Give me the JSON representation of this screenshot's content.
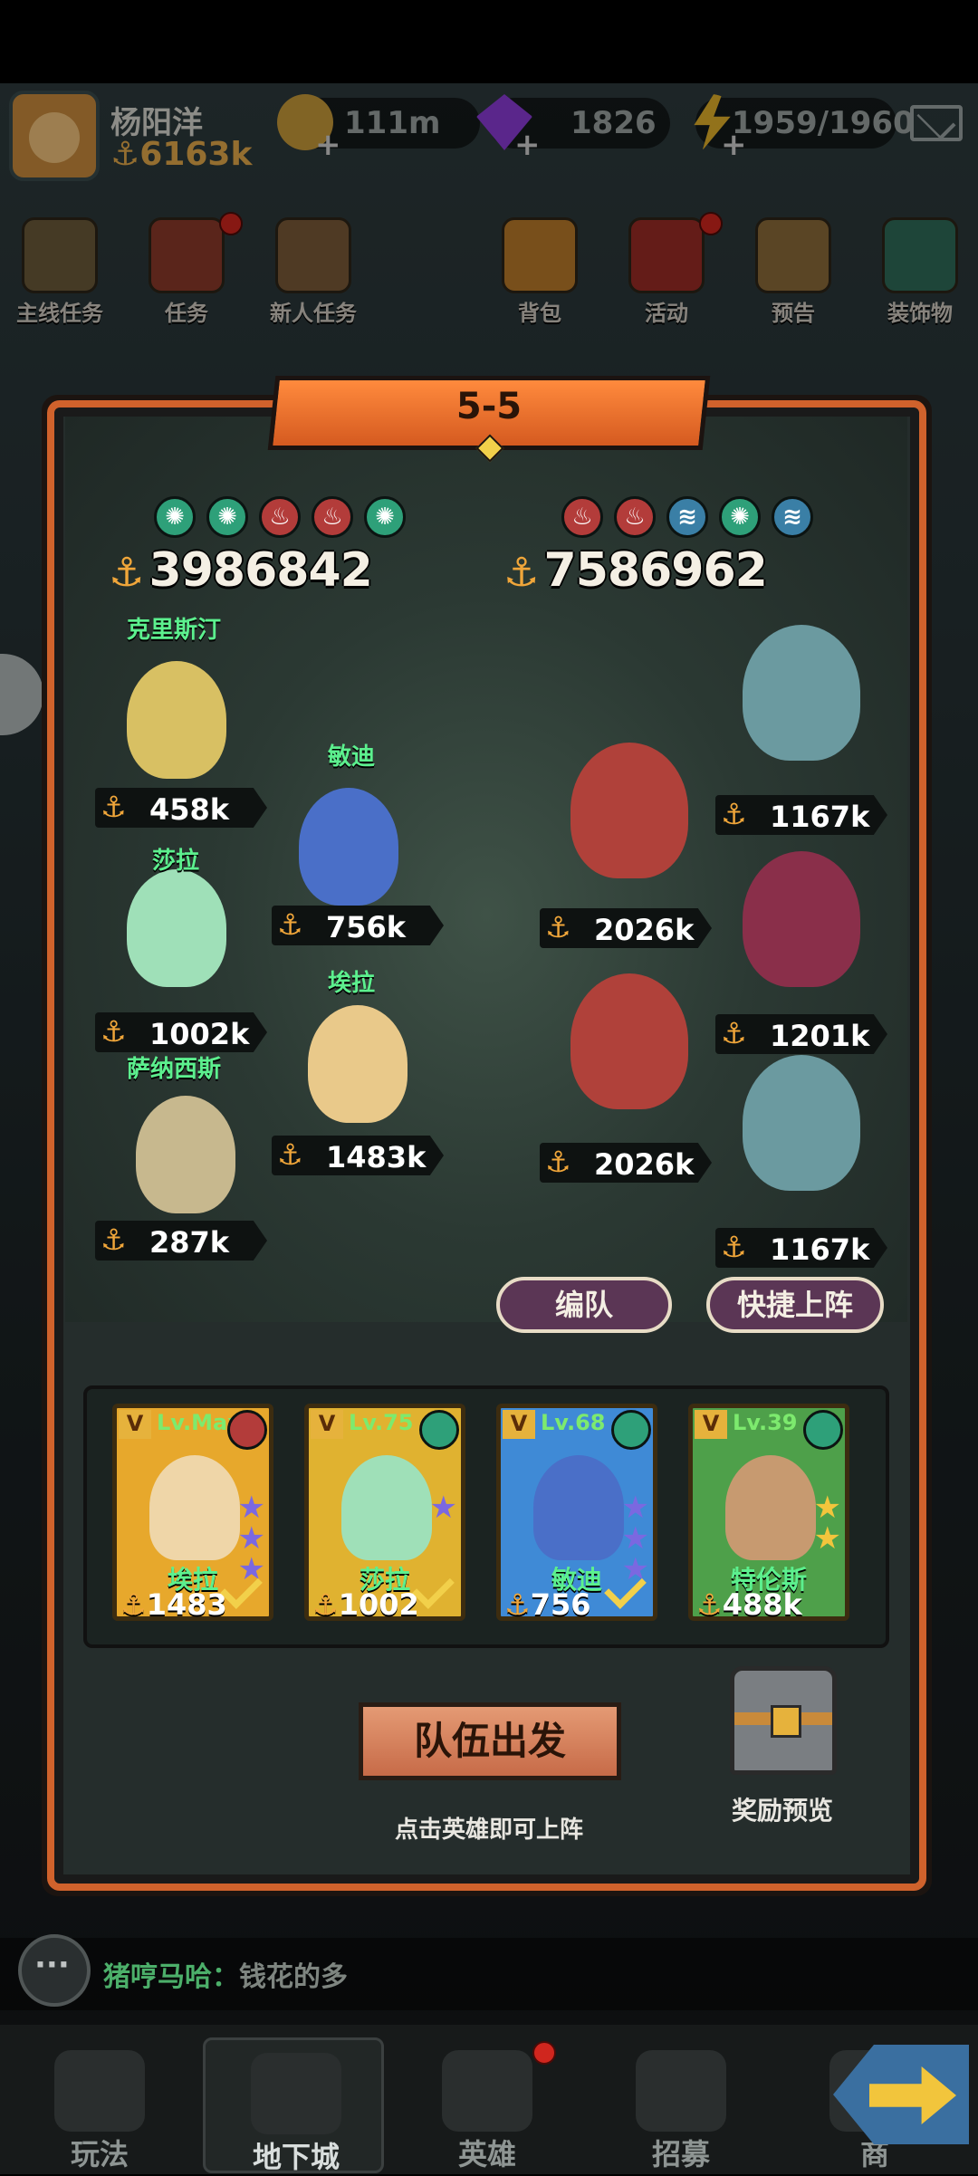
{
  "header": {
    "player_name": "杨阳洋",
    "player_power": "6163k",
    "gold": "111m",
    "gems": "1826",
    "stamina": "1959/1960",
    "avatar_icon": "cat-avatar-icon"
  },
  "menu": [
    {
      "label": "主线任务",
      "dot": false
    },
    {
      "label": "任务",
      "dot": true
    },
    {
      "label": "新人任务",
      "dot": false
    },
    {
      "label": "背包",
      "dot": false
    },
    {
      "label": "活动",
      "dot": true
    },
    {
      "label": "预告",
      "dot": false
    },
    {
      "label": "装饰物",
      "dot": false
    }
  ],
  "battle": {
    "stage": "5-5",
    "ally_power": "3986842",
    "enemy_power": "7586962",
    "ally_elements": [
      "wind",
      "wind",
      "fire",
      "fire",
      "wind"
    ],
    "enemy_elements": [
      "fire",
      "fire",
      "water",
      "wind",
      "water"
    ],
    "allies": [
      {
        "name": "克里斯汀",
        "power": "458k",
        "color": "#d8c063"
      },
      {
        "name": "敏迪",
        "power": "756k",
        "color": "#4a6fc8"
      },
      {
        "name": "莎拉",
        "power": "1002k",
        "color": "#9fe0b8"
      },
      {
        "name": "埃拉",
        "power": "1483k",
        "color": "#e9c98a"
      },
      {
        "name": "萨纳西斯",
        "power": "287k",
        "color": "#c7b88e"
      }
    ],
    "enemies": [
      {
        "power": "1167k",
        "color": "#6b9aa0"
      },
      {
        "power": "2026k",
        "color": "#b0413a"
      },
      {
        "power": "1201k",
        "color": "#8a2f4a"
      },
      {
        "power": "2026k",
        "color": "#b0413a"
      },
      {
        "power": "1167k",
        "color": "#6b9aa0"
      }
    ],
    "formation_label": "编队",
    "quick_label": "快捷上阵"
  },
  "roster": [
    {
      "level": "Lv.Max",
      "name": "埃拉",
      "power": "1483",
      "bg": "#e7a82c",
      "element": "fire",
      "stars": 3,
      "star_color": "#7b68e0",
      "hero_color": "#efd6a8",
      "selected": true
    },
    {
      "level": "Lv.75",
      "name": "莎拉",
      "power": "1002",
      "bg": "#e0b230",
      "element": "wind",
      "stars": 1,
      "star_color": "#7b68e0",
      "hero_color": "#9fe0b8",
      "selected": true
    },
    {
      "level": "Lv.68",
      "name": "敏迪",
      "power": "756",
      "bg": "#3f8ad6",
      "element": "wind",
      "stars": 3,
      "star_color": "#7b68e0",
      "hero_color": "#4a6fc8",
      "selected": true
    },
    {
      "level": "Lv.39",
      "name": "特伦斯",
      "power": "488k",
      "bg": "#4ea04a",
      "element": "wind",
      "stars": 2,
      "star_color": "#f2c53c",
      "hero_color": "#c79a70",
      "selected": false
    }
  ],
  "depart_label": "队伍出发",
  "hint": "点击英雄即可上阵",
  "reward_label": "奖励预览",
  "chat": {
    "user": "猪哼马哈：",
    "message": "钱花的多"
  },
  "nav": [
    {
      "label": "玩法",
      "active": false,
      "dot": false
    },
    {
      "label": "地下城",
      "active": true,
      "dot": false
    },
    {
      "label": "英雄",
      "active": false,
      "dot": true
    },
    {
      "label": "招募",
      "active": false,
      "dot": false
    },
    {
      "label": "商",
      "active": false,
      "dot": false
    }
  ],
  "colors": {
    "accent": "#d0622c",
    "power_gold": "#f0a63a",
    "hero_name": "#5cf08e"
  }
}
